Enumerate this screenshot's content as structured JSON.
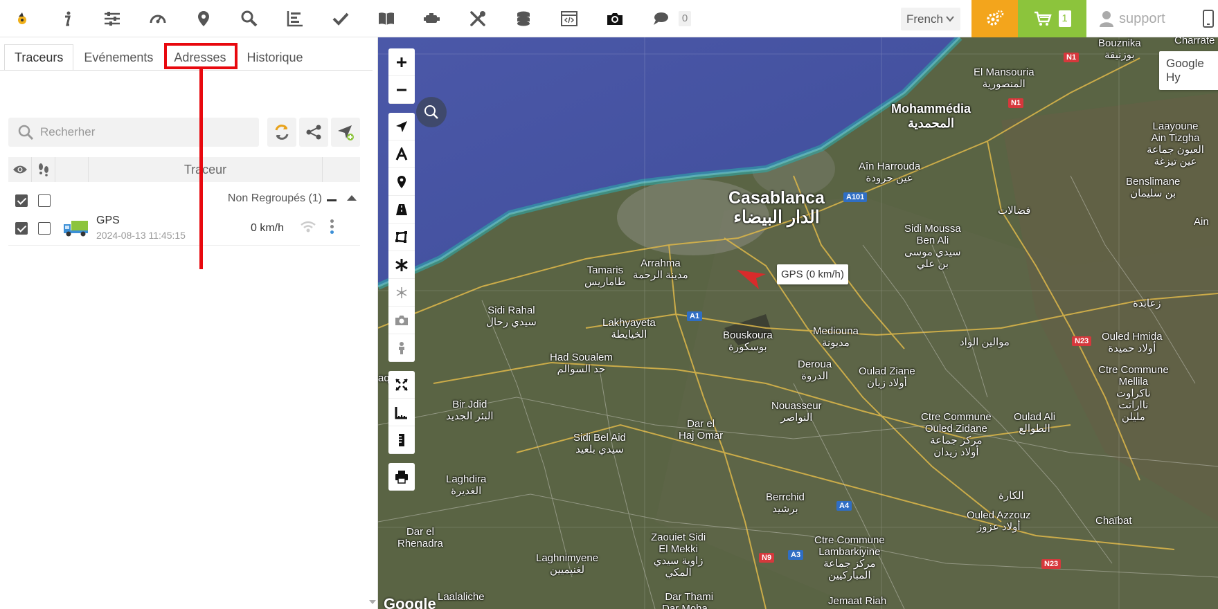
{
  "toolbar": {
    "icons": [
      "logo-icon",
      "info-icon",
      "sliders-icon",
      "speedometer-icon",
      "location-pin-icon",
      "search-icon",
      "chart-icon",
      "check-icon",
      "book-icon",
      "engine-icon",
      "tools-icon",
      "coins-icon",
      "code-window-icon",
      "camera-icon",
      "chat-icon"
    ],
    "notification_count": "0",
    "language": "French",
    "cart_count": "1",
    "user_name": "support"
  },
  "sidebar": {
    "tabs": [
      "Traceurs",
      "Evénements",
      "Adresses",
      "Historique"
    ],
    "active_tab": "Traceurs",
    "search_placeholder": "Recherher",
    "table_header": "Traceur",
    "group": {
      "label": "Non Regroupés (1)"
    },
    "devices": [
      {
        "name": "GPS",
        "timestamp": "2024-08-13 11:45:15",
        "speed": "0 km/h"
      }
    ]
  },
  "map": {
    "marker_label": "GPS (0 km/h)",
    "layer_label": "Google Hy",
    "attribution": "Google",
    "places": [
      {
        "name": "Casablanca\nالدار البيضاء",
        "size": "big"
      },
      {
        "name": "Mohammédia\nالمحمدية",
        "size": "med"
      },
      {
        "name": "Bouznika\nبوزنيقة"
      },
      {
        "name": "El Mansouria\nالمنصورية"
      },
      {
        "name": "Laayoune\nAin Tizgha\nالعيون جماعة\nعين تيزغة"
      },
      {
        "name": "Aîn Harrouda\nعين حرودة"
      },
      {
        "name": "Benslimane\nبن سليمان"
      },
      {
        "name": "فضالات"
      },
      {
        "name": "Sidi Moussa\nBen Ali\nسيدي موسى\nبن علي"
      },
      {
        "name": "Arrahma\nمدينة الرحمة"
      },
      {
        "name": "Tamaris\nطاماريس"
      },
      {
        "name": "Sidi Rahal\nسيدي رحال"
      },
      {
        "name": "Lakhyayeta\nالخيايطة"
      },
      {
        "name": "Bouskoura\nبوسكورة"
      },
      {
        "name": "Mediouna\nمديونة"
      },
      {
        "name": "موالين الواد"
      },
      {
        "name": "زعابدة"
      },
      {
        "name": "Ouled Hmida\nأولاد حميدة"
      },
      {
        "name": "Had Soualem\nحد السوالم"
      },
      {
        "name": "Deroua\nالدروة"
      },
      {
        "name": "Oulad Ziane\nأولاد زيان"
      },
      {
        "name": "Ctre Commune\nMellila\nناكراوت\nنااراتت\nمليلن"
      },
      {
        "name": "Bir Jdid\nالبئر الجديد"
      },
      {
        "name": "Nouasseur\nالنواصر"
      },
      {
        "name": "Ctre Commune\nOuled Zidane\nمركز جماعة\nأولاد زيدان"
      },
      {
        "name": "Oulad Ali\nالطوالع"
      },
      {
        "name": "Sidi Bel Aid\nسيدي بلعيد"
      },
      {
        "name": "Dar el\nHaj Omar"
      },
      {
        "name": "Laghdira\nالغديرة"
      },
      {
        "name": "Berrchid\nبرشيد"
      },
      {
        "name": "الكارة"
      },
      {
        "name": "Ouled Azzouz\nأولاد عزوز"
      },
      {
        "name": "Chaïbat"
      },
      {
        "name": "Dar el\nRhenadra"
      },
      {
        "name": "Zaouiet Sidi\nEl Mekki\nزاوية سيدي\nالمكي"
      },
      {
        "name": "Ctre Commune\nLambarkiyine\nمركز جماعة\nالمباركيين"
      },
      {
        "name": "Laghnimyene\nلغنيميين"
      },
      {
        "name": "Laalaliche"
      },
      {
        "name": "Dar Thami\nDar Moha..."
      },
      {
        "name": "Jemaat Riah"
      },
      {
        "name": "Ain"
      },
      {
        "name": "Charrate"
      },
      {
        "name": "aqoub"
      }
    ],
    "road_shields": [
      "N1",
      "N1",
      "A101",
      "A1",
      "N23",
      "A4",
      "N9",
      "A3",
      "N23"
    ]
  },
  "colors": {
    "settings_bg": "#f3a51c",
    "cart_bg": "#8cc43c",
    "highlight": "#e8080e",
    "marker": "#d92b2b"
  }
}
